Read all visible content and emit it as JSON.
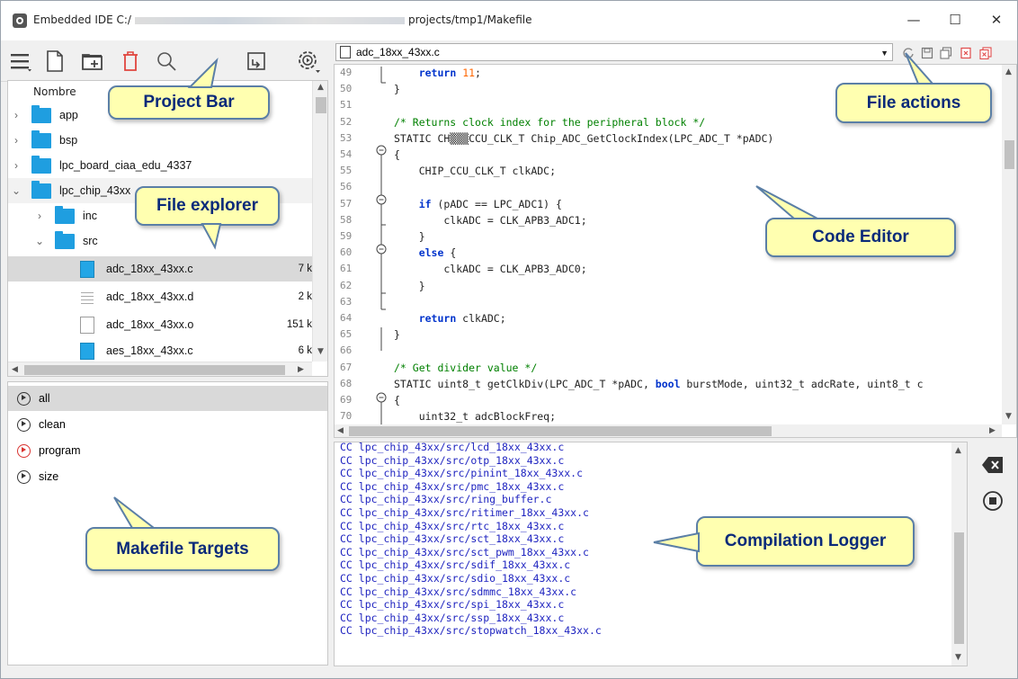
{
  "window": {
    "title_prefix": "Embedded IDE C:/",
    "title_suffix": "projects/tmp1/Makefile",
    "minimize": "—",
    "maximize": "☐",
    "close": "✕"
  },
  "explorer": {
    "header": "Nombre",
    "items": [
      {
        "label": "app",
        "type": "folder",
        "expanded": false
      },
      {
        "label": "bsp",
        "type": "folder",
        "expanded": false
      },
      {
        "label": "lpc_board_ciaa_edu_4337",
        "type": "folder",
        "expanded": false
      },
      {
        "label": "lpc_chip_43xx",
        "type": "folder",
        "expanded": true
      },
      {
        "label": "inc",
        "type": "folder",
        "expanded": false
      },
      {
        "label": "src",
        "type": "folder",
        "expanded": true
      },
      {
        "label": "adc_18xx_43xx.c",
        "type": "c",
        "size": "7 k"
      },
      {
        "label": "adc_18xx_43xx.d",
        "type": "d",
        "size": "2 k"
      },
      {
        "label": "adc_18xx_43xx.o",
        "type": "o",
        "size": "151 k"
      },
      {
        "label": "aes_18xx_43xx.c",
        "type": "c",
        "size": "6 k"
      }
    ]
  },
  "targets": {
    "items": [
      "all",
      "clean",
      "program",
      "size"
    ]
  },
  "editor": {
    "current_file": "adc_18xx_43xx.c",
    "line_numbers": [
      "49",
      "50",
      "51",
      "52",
      "53",
      "54",
      "55",
      "56",
      "57",
      "58",
      "59",
      "60",
      "61",
      "62",
      "63",
      "64",
      "65",
      "66",
      "67",
      "68",
      "69",
      "70"
    ],
    "lines": [
      "    return 11;",
      "}",
      "",
      "/* Returns clock index for the peripheral block */",
      "STATIC CH▒▒▒CCU_CLK_T Chip_ADC_GetClockIndex(LPC_ADC_T *pADC)",
      "{",
      "    CHIP_CCU_CLK_T clkADC;",
      "",
      "    if (pADC == LPC_ADC1) {",
      "        clkADC = CLK_APB3_ADC1;",
      "    }",
      "    else {",
      "        clkADC = CLK_APB3_ADC0;",
      "    }",
      "",
      "    return clkADC;",
      "}",
      "",
      "/* Get divider value */",
      "STATIC uint8_t getClkDiv(LPC_ADC_T *pADC, bool burstMode, uint32_t adcRate, uint8_t c",
      "{",
      "    uint32_t adcBlockFreq;"
    ]
  },
  "logger": {
    "lines": [
      "CC lpc_chip_43xx/src/lcd_18xx_43xx.c",
      "CC lpc_chip_43xx/src/otp_18xx_43xx.c",
      "CC lpc_chip_43xx/src/pinint_18xx_43xx.c",
      "CC lpc_chip_43xx/src/pmc_18xx_43xx.c",
      "CC lpc_chip_43xx/src/ring_buffer.c",
      "CC lpc_chip_43xx/src/ritimer_18xx_43xx.c",
      "CC lpc_chip_43xx/src/rtc_18xx_43xx.c",
      "CC lpc_chip_43xx/src/sct_18xx_43xx.c",
      "CC lpc_chip_43xx/src/sct_pwm_18xx_43xx.c",
      "CC lpc_chip_43xx/src/sdif_18xx_43xx.c",
      "CC lpc_chip_43xx/src/sdio_18xx_43xx.c",
      "CC lpc_chip_43xx/src/sdmmc_18xx_43xx.c",
      "CC lpc_chip_43xx/src/spi_18xx_43xx.c",
      "CC lpc_chip_43xx/src/ssp_18xx_43xx.c",
      "CC lpc_chip_43xx/src/stopwatch_18xx_43xx.c"
    ]
  },
  "callouts": {
    "project_bar": "Project Bar",
    "file_explorer": "File explorer",
    "makefile_targets": "Makefile Targets",
    "file_actions": "File actions",
    "code_editor": "Code Editor",
    "compilation_logger": "Compilation Logger"
  },
  "colors": {
    "folder": "#1f9ee0",
    "c_file": "#23a6e6",
    "keyword": "#0033cc",
    "comment": "#008000",
    "number": "#ff6600",
    "log_text": "#1f24c0",
    "callout_bg": "#ffffb0",
    "callout_text": "#0a2a7a",
    "program_target": "#d9322f"
  },
  "icons": {
    "toolbar": [
      "hamburger-menu-icon",
      "new-file-icon",
      "new-folder-icon",
      "delete-icon",
      "search-icon",
      "export-icon",
      "build-settings-icon"
    ],
    "file_actions": [
      "reload-icon",
      "save-icon",
      "save-all-icon",
      "close-icon",
      "close-all-icon"
    ],
    "logger_side": [
      "clear-log-icon",
      "stop-icon"
    ]
  }
}
